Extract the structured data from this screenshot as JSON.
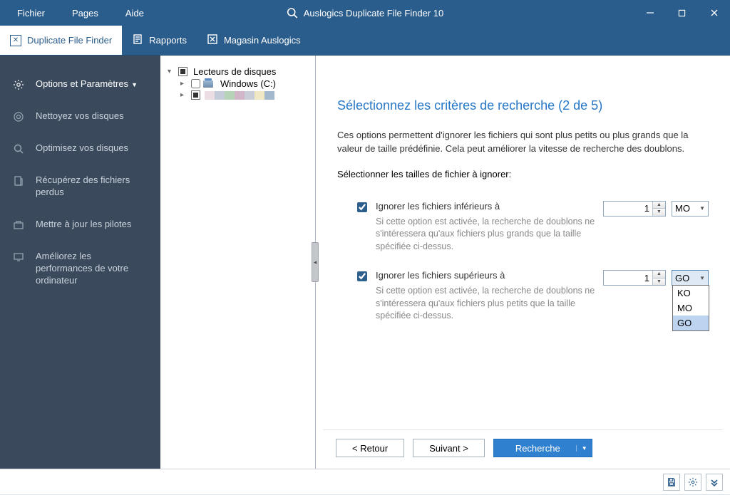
{
  "menu": {
    "file": "Fichier",
    "pages": "Pages",
    "help": "Aide"
  },
  "app_title": "Auslogics Duplicate File Finder 10",
  "ribbon": {
    "dff": "Duplicate File Finder",
    "reports": "Rapports",
    "store": "Magasin Auslogics"
  },
  "sidebar": {
    "options": "Options et Paramètres",
    "clean": "Nettoyez vos disques",
    "optimize": "Optimisez vos disques",
    "recover": "Récupérez des fichiers perdus",
    "update": "Mettre à jour les pilotes",
    "improve": "Améliorez les performances de votre ordinateur"
  },
  "tree": {
    "root": "Lecteurs de disques",
    "windows": "Windows (C:)"
  },
  "main": {
    "title": "Sélectionnez les critères de recherche (2 de 5)",
    "intro": "Ces options permettent d'ignorer les fichiers qui sont plus petits ou plus grands que la valeur de taille prédéfinie. Cela peut améliorer la vitesse de recherche des doublons.",
    "sub_heading": "Sélectionner les tailles de fichier à ignorer:",
    "smaller": {
      "label": "Ignorer les fichiers inférieurs à",
      "desc": "Si cette option est activée, la recherche de doublons ne s'intéressera qu'aux fichiers plus grands que la taille spécifiée ci-dessus.",
      "value": "1",
      "unit": "MO"
    },
    "larger": {
      "label": "Ignorer les fichiers supérieurs à",
      "desc": "Si cette option est activée, la recherche de doublons ne s'intéressera qu'aux fichiers plus petits que la taille spécifiée ci-dessus.",
      "value": "1",
      "unit": "GO"
    },
    "units": {
      "ko": "KO",
      "mo": "MO",
      "go": "GO"
    }
  },
  "nav": {
    "back": "<  Retour",
    "next": "Suivant  >",
    "search": "Recherche"
  }
}
